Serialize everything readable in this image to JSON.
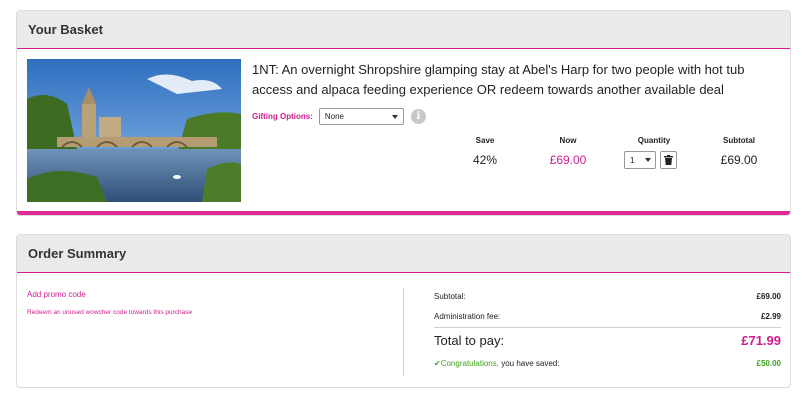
{
  "basket": {
    "header": "Your Basket",
    "item": {
      "image_alt_icon": "landscape-photo",
      "title": "1NT: An overnight Shropshire glamping stay at Abel's Harp for two people with hot tub access and alpaca feeding experience OR redeem towards another available deal",
      "gifting_label": "Gifting Options:",
      "gifting_value": "None",
      "info_icon": "info-icon",
      "columns": {
        "save": "Save",
        "now": "Now",
        "quantity": "Quantity",
        "subtotal": "Subtotal"
      },
      "values": {
        "save": "42%",
        "now": "£69.00",
        "quantity": "1",
        "subtotal": "£69.00"
      }
    }
  },
  "summary": {
    "header": "Order Summary",
    "promo_link": "Add promo code",
    "redeem_link": "Redeem an unused wowcher code towards this purchase",
    "rows": {
      "subtotal_label": "Subtotal:",
      "subtotal_value": "£69.00",
      "admin_label": "Administration fee:",
      "admin_value": "£2.99",
      "total_label": "Total to pay:",
      "total_value": "£71.99",
      "congrats_word": "Congratulations,",
      "congrats_rest": " you have saved:",
      "saved_value": "£50.00"
    }
  },
  "colors": {
    "accent": "#d11c8e",
    "success": "#3fa320"
  }
}
